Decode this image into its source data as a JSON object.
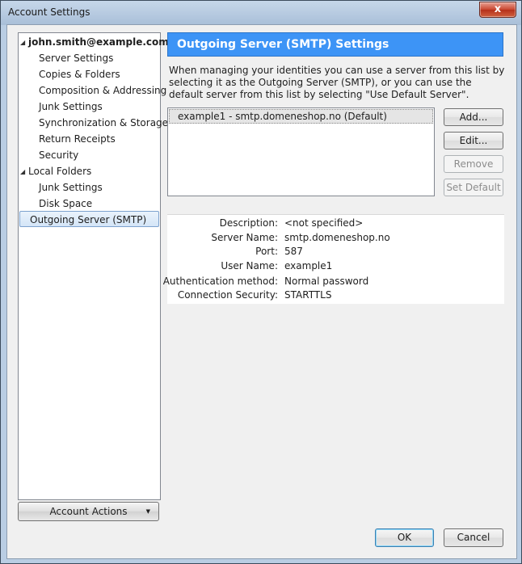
{
  "window": {
    "title": "Account Settings",
    "close_label": "x"
  },
  "sidebar": {
    "account": "john.smith@example.com",
    "account_children": [
      "Server Settings",
      "Copies & Folders",
      "Composition & Addressing",
      "Junk Settings",
      "Synchronization & Storage",
      "Return Receipts",
      "Security"
    ],
    "local_folders": "Local Folders",
    "local_children": [
      "Junk Settings",
      "Disk Space"
    ],
    "outgoing": "Outgoing Server (SMTP)",
    "account_actions_label": "Account Actions"
  },
  "main": {
    "header": "Outgoing Server (SMTP) Settings",
    "description": "When managing your identities you can use a server from this list by selecting it as the Outgoing Server (SMTP), or you can use the default server from this list by selecting \"Use Default Server\".",
    "servers": [
      "example1 - smtp.domeneshop.no (Default)"
    ],
    "buttons": {
      "add": "Add...",
      "edit": "Edit...",
      "remove": "Remove",
      "set_default": "Set Default"
    },
    "details": [
      {
        "key": "Description:",
        "value": "<not specified>"
      },
      {
        "key": "Server Name:",
        "value": "smtp.domeneshop.no"
      },
      {
        "key": "Port:",
        "value": "587"
      },
      {
        "key": "User Name:",
        "value": "example1"
      },
      {
        "key": "Authentication method:",
        "value": "Normal password"
      },
      {
        "key": "Connection Security:",
        "value": "STARTTLS"
      }
    ]
  },
  "footer": {
    "ok": "OK",
    "cancel": "Cancel"
  },
  "colors": {
    "header_bg": "#3d94f6",
    "selection_bg": "#dbe9f8"
  }
}
